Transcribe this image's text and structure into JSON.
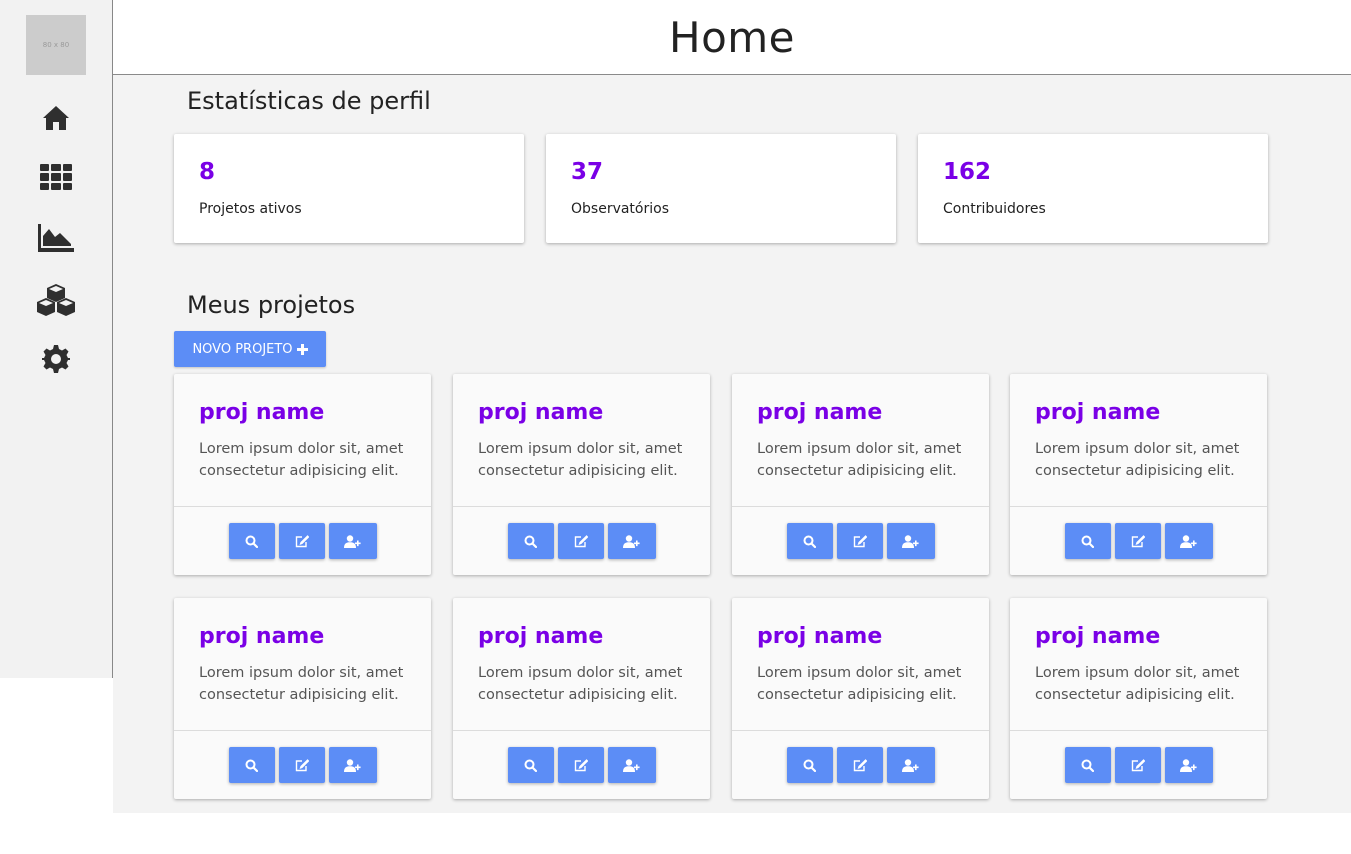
{
  "header": {
    "title": "Home"
  },
  "sidebar": {
    "avatar_text": "80 x 80",
    "items": [
      {
        "icon": "home-icon"
      },
      {
        "icon": "grid-icon"
      },
      {
        "icon": "area-chart-icon"
      },
      {
        "icon": "cubes-icon"
      },
      {
        "icon": "gear-icon"
      }
    ]
  },
  "stats": {
    "title": "Estatísticas de perfil",
    "items": [
      {
        "value": "8",
        "label": "Projetos ativos"
      },
      {
        "value": "37",
        "label": "Observatórios"
      },
      {
        "value": "162",
        "label": "Contribuidores"
      }
    ]
  },
  "projects": {
    "title": "Meus projetos",
    "new_button_label": "NOVO PROJETO",
    "items": [
      {
        "name": "proj name",
        "description": "Lorem ipsum dolor sit, amet consectetur adipisicing elit."
      },
      {
        "name": "proj name",
        "description": "Lorem ipsum dolor sit, amet consectetur adipisicing elit."
      },
      {
        "name": "proj name",
        "description": "Lorem ipsum dolor sit, amet consectetur adipisicing elit."
      },
      {
        "name": "proj name",
        "description": "Lorem ipsum dolor sit, amet consectetur adipisicing elit."
      },
      {
        "name": "proj name",
        "description": "Lorem ipsum dolor sit, amet consectetur adipisicing elit."
      },
      {
        "name": "proj name",
        "description": "Lorem ipsum dolor sit, amet consectetur adipisicing elit."
      },
      {
        "name": "proj name",
        "description": "Lorem ipsum dolor sit, amet consectetur adipisicing elit."
      },
      {
        "name": "proj name",
        "description": "Lorem ipsum dolor sit, amet consectetur adipisicing elit."
      }
    ],
    "card_actions": [
      "search-icon",
      "edit-icon",
      "add-user-icon"
    ]
  },
  "colors": {
    "accent_purple": "#7a00e6",
    "button_blue": "#5c8df6",
    "sidebar_bg": "#f2f2f2",
    "main_bg": "#f3f3f3"
  }
}
